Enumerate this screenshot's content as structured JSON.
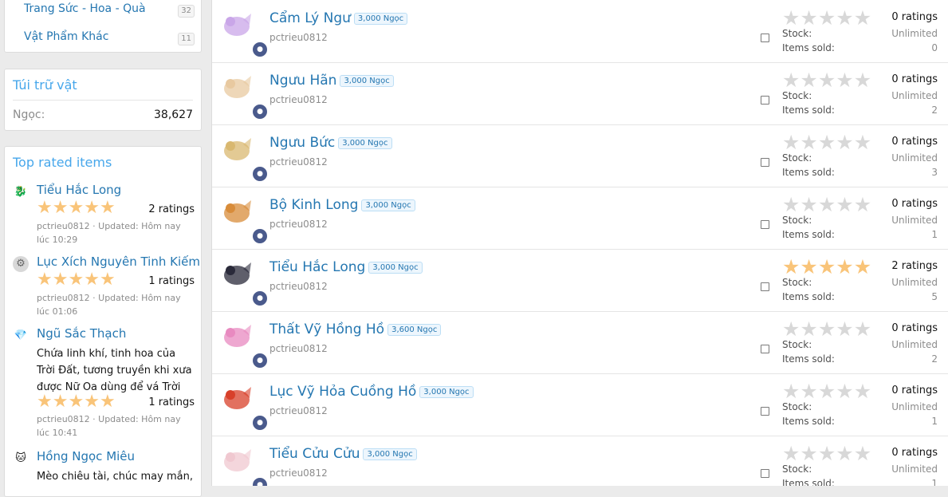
{
  "sidebar": {
    "categories": [
      {
        "label": "Trang Sức - Hoa - Quà",
        "count": "32"
      },
      {
        "label": "Vật Phẩm Khác",
        "count": "11"
      }
    ],
    "wallet": {
      "title": "Túi trữ vật",
      "label": "Ngọc:",
      "value": "38,627"
    },
    "top_rated": {
      "title": "Top rated items",
      "items": [
        {
          "name": "Tiểu Hắc Long",
          "desc": "",
          "rating_text": "2 ratings",
          "stars": 5,
          "meta": "pctrieu0812 · Updated: Hôm nay lúc 10:29",
          "icon": "dragon-icon"
        },
        {
          "name": "Lục Xích Nguyên Tinh Kiếm",
          "desc": "",
          "rating_text": "1 ratings",
          "stars": 5,
          "meta": "pctrieu0812 · Updated: Hôm nay lúc 01:06",
          "icon": "gear-icon"
        },
        {
          "name": "Ngũ Sắc Thạch",
          "desc": "Chứa linh khí, tinh hoa của Trời Đất, tương truyền khi xưa được Nữ Oa dùng để vá Trời",
          "rating_text": "1 ratings",
          "stars": 5,
          "meta": "pctrieu0812 · Updated: Hôm nay lúc 10:41",
          "icon": "gem-icon"
        },
        {
          "name": "Hồng Ngọc Miêu",
          "desc": "Mèo chiêu tài, chúc may mắn,",
          "rating_text": "",
          "stars": 0,
          "meta": "",
          "icon": "cat-icon"
        }
      ]
    }
  },
  "labels": {
    "stock": "Stock:",
    "sold": "Items sold:"
  },
  "items": [
    {
      "title": "Cẩm Lý Ngư",
      "price": "3,000 Ngọc",
      "user": "pctrieu0812",
      "stars": 0,
      "rating_text": "0 ratings",
      "stock": "Unlimited",
      "sold": "0",
      "color": "#c9a6e8"
    },
    {
      "title": "Ngưu Hãn",
      "price": "3,000 Ngọc",
      "user": "pctrieu0812",
      "stars": 0,
      "rating_text": "0 ratings",
      "stock": "Unlimited",
      "sold": "2",
      "color": "#e8c9a0"
    },
    {
      "title": "Ngưu Bức",
      "price": "3,000 Ngọc",
      "user": "pctrieu0812",
      "stars": 0,
      "rating_text": "0 ratings",
      "stock": "Unlimited",
      "sold": "3",
      "color": "#d9b870"
    },
    {
      "title": "Bộ Kinh Long",
      "price": "3,000 Ngọc",
      "user": "pctrieu0812",
      "stars": 0,
      "rating_text": "0 ratings",
      "stock": "Unlimited",
      "sold": "1",
      "color": "#d88c3a"
    },
    {
      "title": "Tiểu Hắc Long",
      "price": "3,000 Ngọc",
      "user": "pctrieu0812",
      "stars": 5,
      "rating_text": "2 ratings",
      "stock": "Unlimited",
      "sold": "5",
      "color": "#2a2a3a"
    },
    {
      "title": "Thất Vỹ Hồng Hồ",
      "price": "3,600 Ngọc",
      "user": "pctrieu0812",
      "stars": 0,
      "rating_text": "0 ratings",
      "stock": "Unlimited",
      "sold": "2",
      "color": "#e88ac0"
    },
    {
      "title": "Lục Vỹ Hỏa Cuồng Hồ",
      "price": "3,000 Ngọc",
      "user": "pctrieu0812",
      "stars": 0,
      "rating_text": "0 ratings",
      "stock": "Unlimited",
      "sold": "1",
      "color": "#d8402a"
    },
    {
      "title": "Tiểu Cửu Cửu",
      "price": "3,000 Ngọc",
      "user": "pctrieu0812",
      "stars": 0,
      "rating_text": "0 ratings",
      "stock": "Unlimited",
      "sold": "1",
      "color": "#f0c8d0"
    }
  ]
}
